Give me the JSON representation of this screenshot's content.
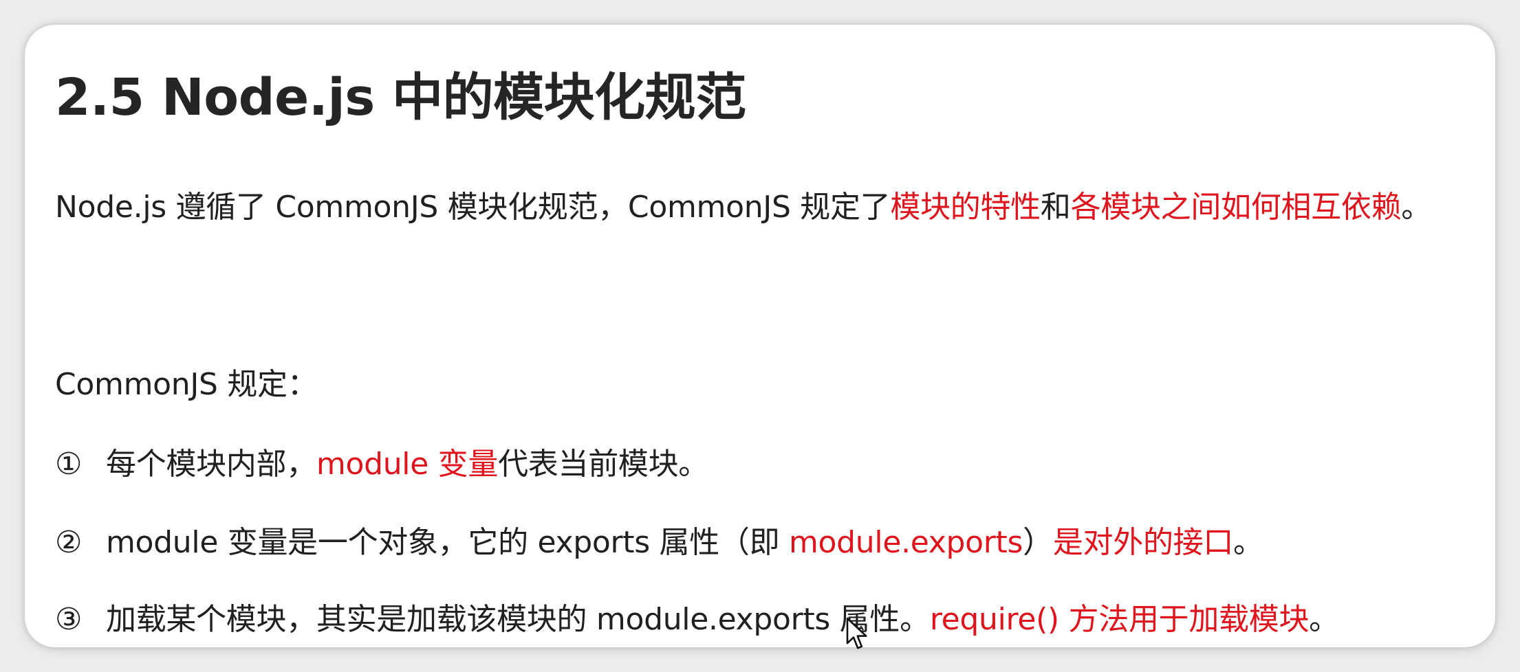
{
  "title": "2.5 Node.js 中的模块化规范",
  "intro": {
    "text1": "Node.js 遵循了 CommonJS 模块化规范，CommonJS 规定了",
    "red1": "模块的特性",
    "text2": "和",
    "red2": "各模块之间如何相互依赖",
    "text3": "。"
  },
  "rules_heading": "CommonJS 规定：",
  "items": [
    {
      "num": "①",
      "text1": "每个模块内部，",
      "red1": "module 变量",
      "text2": "代表当前模块。"
    },
    {
      "num": "②",
      "text1": "module 变量是一个对象，它的 exports 属性（即 ",
      "red1": "module.exports",
      "text2": "）",
      "red2": "是对外的接口",
      "text3": "。"
    },
    {
      "num": "③",
      "text1": "加载某个模块，其实是加载该模块的 module.exports 属性。",
      "red1": "require() 方法用于加载模块",
      "text2": "。"
    }
  ],
  "colors": {
    "text": "#202020",
    "highlight": "#e0141d",
    "background": "#ffffff"
  },
  "icons": {
    "cursor": "mouse-pointer-icon"
  }
}
